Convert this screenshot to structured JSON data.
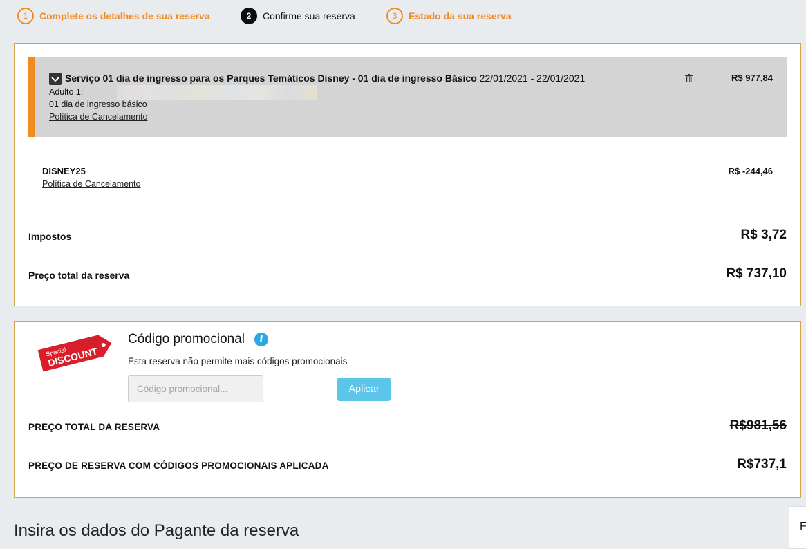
{
  "steps": [
    {
      "number": "1",
      "label": "Complete os detalhes de sua reserva"
    },
    {
      "number": "2",
      "label": "Confirme sua reserva"
    },
    {
      "number": "3",
      "label": "Estado da sua reserva"
    }
  ],
  "booking": {
    "service_title": "Serviço 01 dia de ingresso para os Parques Temáticos Disney - 01 dia de ingresso Básico",
    "service_dates": "22/01/2021 - 22/01/2021",
    "adult_label": "Adulto 1:",
    "ticket_type": "01 dia de ingresso básico",
    "cancellation_link": "Política de Cancelamento",
    "service_price": "R$ 977,84",
    "promo_code": "DISNEY25",
    "promo_cancellation_link": "Política de Cancelamento",
    "promo_discount": "R$ -244,46",
    "taxes_label": "Impostos",
    "taxes_value": "R$ 3,72",
    "total_label": "Preço total da reserva",
    "total_value": "R$ 737,10"
  },
  "promo": {
    "badge_text_top": "Special",
    "badge_text_main": "DISCOUNT",
    "title": "Código promocional",
    "message": "Esta reserva não permite mais códigos promocionais",
    "input_placeholder": "Código promocional...",
    "apply_label": "Aplicar",
    "total_label": "PREÇO TOTAL DA RESERVA",
    "total_original": "R$981,56",
    "discounted_label": "PREÇO DE RESERVA COM CÓDIGOS PROMOCIONAIS APLICADA",
    "discounted_value": "R$737,1"
  },
  "payer": {
    "heading": "Insira os dados do Pagante da reserva",
    "side_tab_text": "F"
  },
  "colors": {
    "accent_orange": "#f08a24",
    "panel_border": "#d4a24b",
    "apply_button": "#5bc6ea",
    "info_icon": "#2aa8df",
    "discount_tag": "#d81e2a"
  }
}
